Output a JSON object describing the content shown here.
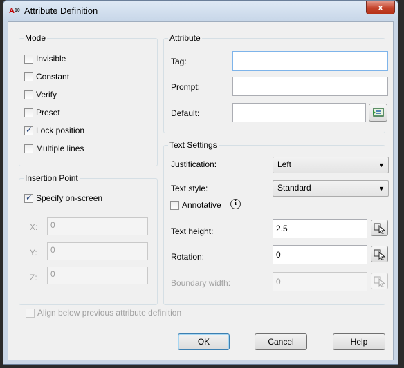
{
  "window": {
    "title": "Attribute Definition",
    "app_icon_letter": "A",
    "app_icon_sub": "10",
    "close_label": "x"
  },
  "mode": {
    "title": "Mode",
    "items": [
      {
        "label": "Invisible",
        "checked": false
      },
      {
        "label": "Constant",
        "checked": false
      },
      {
        "label": "Verify",
        "checked": false
      },
      {
        "label": "Preset",
        "checked": false
      },
      {
        "label": "Lock position",
        "checked": true
      },
      {
        "label": "Multiple lines",
        "checked": false
      }
    ]
  },
  "insertion": {
    "title": "Insertion Point",
    "specify_label": "Specify on-screen",
    "specify_checked": true,
    "x_label": "X:",
    "x_value": "0",
    "y_label": "Y:",
    "y_value": "0",
    "z_label": "Z:",
    "z_value": "0"
  },
  "attribute": {
    "title": "Attribute",
    "tag_label": "Tag:",
    "tag_value": "",
    "prompt_label": "Prompt:",
    "prompt_value": "",
    "default_label": "Default:",
    "default_value": ""
  },
  "text_settings": {
    "title": "Text Settings",
    "justification_label": "Justification:",
    "justification_value": "Left",
    "style_label": "Text style:",
    "style_value": "Standard",
    "annotative_label": "Annotative",
    "annotative_checked": false,
    "info_glyph": "i",
    "height_label": "Text height:",
    "height_value": "2.5",
    "rotation_label": "Rotation:",
    "rotation_value": "0",
    "boundary_label": "Boundary width:",
    "boundary_value": "0"
  },
  "align_label": "Align below previous attribute definition",
  "buttons": {
    "ok": "OK",
    "cancel": "Cancel",
    "help": "Help"
  }
}
